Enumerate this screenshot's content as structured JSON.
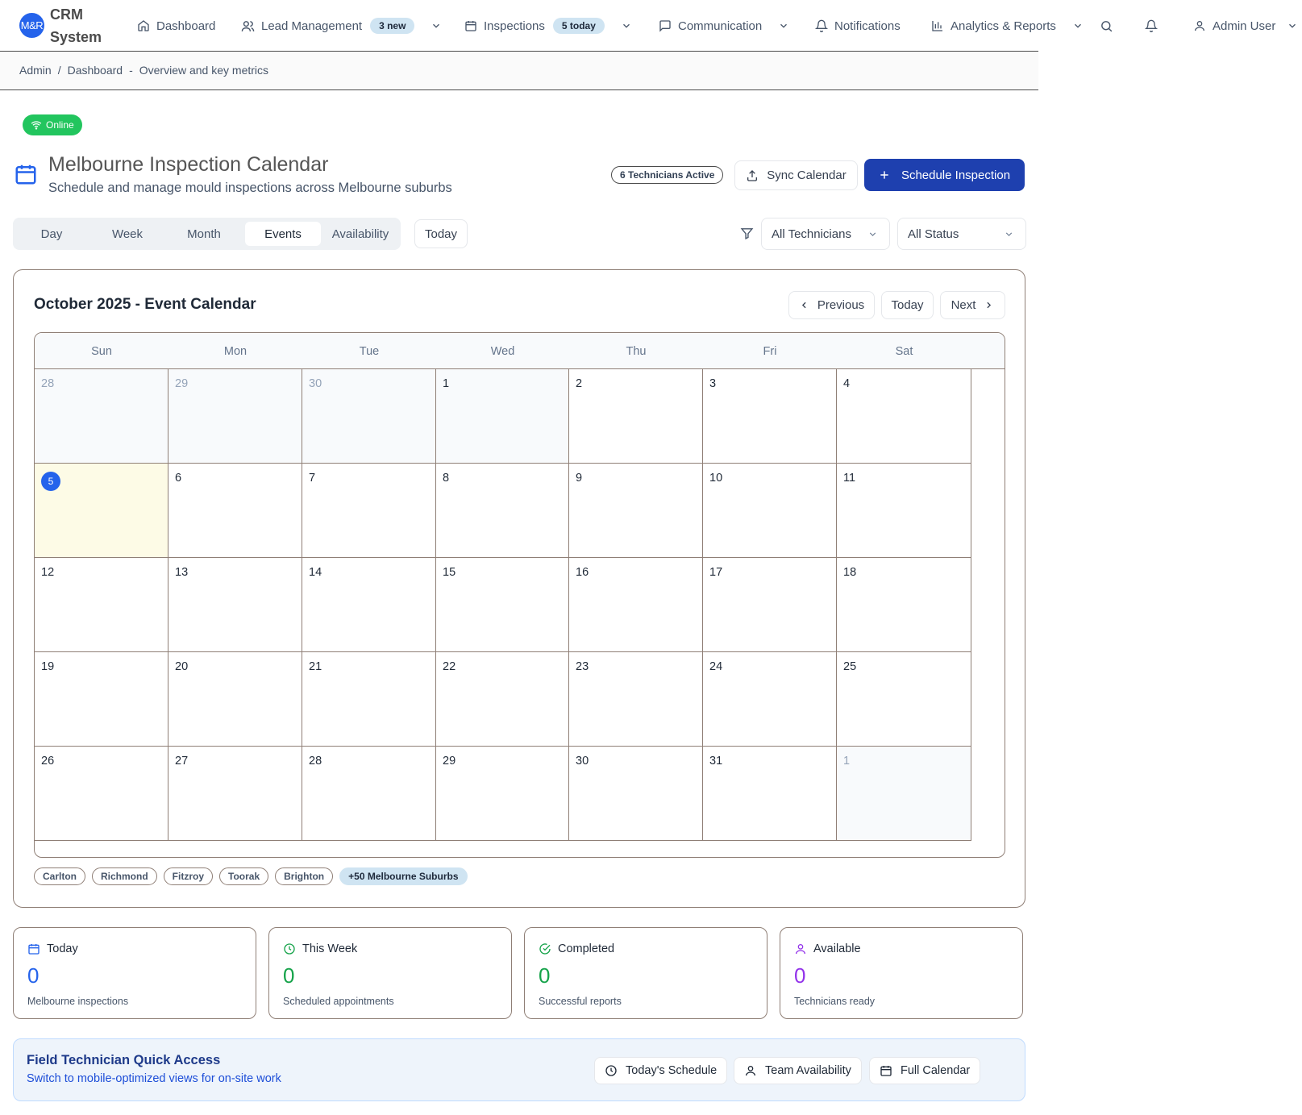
{
  "app": {
    "logo_text": "M&R",
    "brand_line1": "CRM",
    "brand_line2": "System"
  },
  "nav": {
    "dashboard": "Dashboard",
    "lead_management": "Lead Management",
    "lead_badge": "3 new",
    "inspections": "Inspections",
    "inspections_badge": "5 today",
    "communication": "Communication",
    "notifications": "Notifications",
    "analytics": "Analytics & Reports",
    "user": "Admin User"
  },
  "breadcrumb": {
    "root": "Admin",
    "sep": "/",
    "current": "Dashboard",
    "dash": "-",
    "desc": "Overview and key metrics"
  },
  "status": {
    "online": "Online"
  },
  "header": {
    "title": "Melbourne Inspection Calendar",
    "subtitle": "Schedule and manage mould inspections across Melbourne suburbs",
    "tech_badge": "6 Technicians Active",
    "sync": "Sync Calendar",
    "schedule": "Schedule Inspection"
  },
  "views": {
    "day": "Day",
    "week": "Week",
    "month": "Month",
    "events": "Events",
    "availability": "Availability",
    "today": "Today"
  },
  "filters": {
    "technicians": "All Technicians",
    "status": "All Status"
  },
  "calendar": {
    "title": "October 2025 - Event Calendar",
    "previous": "Previous",
    "today": "Today",
    "next": "Next",
    "weekdays": [
      "Sun",
      "Mon",
      "Tue",
      "Wed",
      "Thu",
      "Fri",
      "Sat"
    ],
    "days": [
      {
        "d": "28",
        "state": "faded"
      },
      {
        "d": "29",
        "state": "faded"
      },
      {
        "d": "30",
        "state": "faded"
      },
      {
        "d": "1",
        "state": "muted"
      },
      {
        "d": "2",
        "state": ""
      },
      {
        "d": "3",
        "state": ""
      },
      {
        "d": "4",
        "state": ""
      },
      {
        "d": "5",
        "state": "today"
      },
      {
        "d": "6",
        "state": ""
      },
      {
        "d": "7",
        "state": ""
      },
      {
        "d": "8",
        "state": ""
      },
      {
        "d": "9",
        "state": ""
      },
      {
        "d": "10",
        "state": ""
      },
      {
        "d": "11",
        "state": ""
      },
      {
        "d": "12",
        "state": ""
      },
      {
        "d": "13",
        "state": ""
      },
      {
        "d": "14",
        "state": ""
      },
      {
        "d": "15",
        "state": ""
      },
      {
        "d": "16",
        "state": ""
      },
      {
        "d": "17",
        "state": ""
      },
      {
        "d": "18",
        "state": ""
      },
      {
        "d": "19",
        "state": ""
      },
      {
        "d": "20",
        "state": ""
      },
      {
        "d": "21",
        "state": ""
      },
      {
        "d": "22",
        "state": ""
      },
      {
        "d": "23",
        "state": ""
      },
      {
        "d": "24",
        "state": ""
      },
      {
        "d": "25",
        "state": ""
      },
      {
        "d": "26",
        "state": ""
      },
      {
        "d": "27",
        "state": ""
      },
      {
        "d": "28",
        "state": ""
      },
      {
        "d": "29",
        "state": ""
      },
      {
        "d": "30",
        "state": ""
      },
      {
        "d": "31",
        "state": ""
      },
      {
        "d": "1",
        "state": "faded"
      }
    ],
    "suburbs": [
      "Carlton",
      "Richmond",
      "Fitzroy",
      "Toorak",
      "Brighton"
    ],
    "more_suburbs": "+50 Melbourne Suburbs"
  },
  "stats": [
    {
      "label": "Today",
      "value": "0",
      "desc": "Melbourne inspections",
      "color": "#2563eb",
      "icon": "calendar-icon"
    },
    {
      "label": "This Week",
      "value": "0",
      "desc": "Scheduled appointments",
      "color": "#16a34a",
      "icon": "clock-icon"
    },
    {
      "label": "Completed",
      "value": "0",
      "desc": "Successful reports",
      "color": "#16a34a",
      "icon": "check-circle-icon"
    },
    {
      "label": "Available",
      "value": "0",
      "desc": "Technicians ready",
      "color": "#9333ea",
      "icon": "user-icon"
    }
  ],
  "quick": {
    "title": "Field Technician Quick Access",
    "subtitle": "Switch to mobile-optimized views for on-site work",
    "schedule": "Today's Schedule",
    "team": "Team Availability",
    "full": "Full Calendar"
  }
}
